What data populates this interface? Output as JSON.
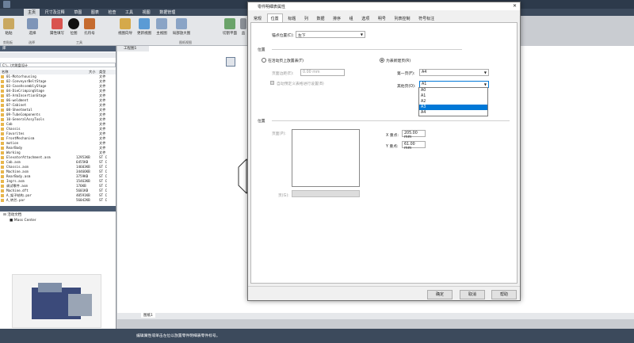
{
  "app": {
    "menus": [
      "主页",
      "尺寸及注释",
      "草图",
      "图表",
      "检查",
      "工具",
      "视图",
      "数据管理"
    ],
    "active_menu": "主页"
  },
  "ribbon": {
    "buttons": [
      "粘贴",
      "选择",
      "属性填写",
      "位图",
      "孔符号",
      "视图向导",
      "更新视图",
      "主视图",
      "局部放大图",
      "切割平面",
      "品"
    ],
    "groups": [
      "剪贴板",
      "选择",
      "工具",
      "图纸视图"
    ]
  },
  "left_panel": {
    "title": "库",
    "path": "C:\\...\\大跳盘设计",
    "columns": [
      "名称",
      "大小",
      "类型"
    ],
    "files": [
      {
        "name": "01-Motorhousing",
        "size": "",
        "type": "文件"
      },
      {
        "name": "02-ConveyorBeltStage",
        "size": "",
        "type": "文件"
      },
      {
        "name": "03-CaseAssemblyStage",
        "size": "",
        "type": "文件"
      },
      {
        "name": "04-DieCrimpingStage",
        "size": "",
        "type": "文件"
      },
      {
        "name": "05-ArmInsertionStage",
        "size": "",
        "type": "文件"
      },
      {
        "name": "06-weldment",
        "size": "",
        "type": "文件"
      },
      {
        "name": "07-Cabinet",
        "size": "",
        "type": "文件"
      },
      {
        "name": "08-Sheetmetal",
        "size": "",
        "type": "文件"
      },
      {
        "name": "09-TubeComponents",
        "size": "",
        "type": "文件"
      },
      {
        "name": "10-GeneralAssyTools",
        "size": "",
        "type": "文件"
      },
      {
        "name": "Cab",
        "size": "",
        "type": "文件"
      },
      {
        "name": "Chassis",
        "size": "",
        "type": "文件"
      },
      {
        "name": "Favorites",
        "size": "",
        "type": "文件"
      },
      {
        "name": "FrontMechanism",
        "size": "",
        "type": "文件"
      },
      {
        "name": "motion",
        "size": "",
        "type": "文件"
      },
      {
        "name": "RearBody",
        "size": "",
        "type": "文件"
      },
      {
        "name": "Working",
        "size": "",
        "type": "文件"
      },
      {
        "name": "ElevatorAttachment.asm",
        "size": "12953KB",
        "type": "ST C"
      },
      {
        "name": "Cab.asm",
        "size": "6455KB",
        "type": "ST C"
      },
      {
        "name": "Chassis.asm",
        "size": "14603KB",
        "type": "ST C"
      },
      {
        "name": "Machine.asm",
        "size": "34466KB",
        "type": "ST C"
      },
      {
        "name": "RearBody.asm",
        "size": "3759KB",
        "type": "ST C"
      },
      {
        "name": "Ingrs.asm",
        "size": "15463KB",
        "type": "ST C"
      },
      {
        "name": "调试零件.asm",
        "size": "176KB",
        "type": "ST C"
      },
      {
        "name": "Machine.dft",
        "size": "5601KB",
        "type": "ST C"
      },
      {
        "name": "A_架子结构.par",
        "size": "40591KB",
        "type": "ST C"
      },
      {
        "name": "A_转芯.par",
        "size": "56042KB",
        "type": "ST C"
      }
    ],
    "tree_root": "活动文档",
    "tree_child": "Mass Center"
  },
  "viewport": {
    "tab": "工程图1",
    "sheet_tab": "图纸1"
  },
  "dialog": {
    "title": "零件明细表属性",
    "tabs": [
      "常规",
      "位置",
      "标题",
      "列",
      "数据",
      "排序",
      "组",
      "选项",
      "明号",
      "列表控制",
      "符号标注"
    ],
    "selected_tab": "位置",
    "anchor_label": "锚点位置(C):",
    "anchor_value": "左下",
    "pos_section": "位置",
    "radio_active_sheet": "在活动页上放置表(T)",
    "page_edge_label": "页面边距(E):",
    "page_edge_value": "0.00 mm",
    "checkbox_preset": "自动预定义表格进行设置(B)",
    "radio_new_sheet": "为表新建页(R)",
    "first_page_label": "第一页(F):",
    "first_page_value": "A4",
    "other_page_label": "其他页(O):",
    "other_page_value": "A1",
    "dropdown_options": [
      "A0",
      "A1",
      "A2",
      "A3",
      "A4"
    ],
    "dropdown_highlight": "A3",
    "place_section": "位置",
    "page_label": "页面(P):",
    "page_value_label": "页(G):",
    "x_label": "X 重点:",
    "x_value": "205.00 mm",
    "y_label": "Y 重点:",
    "y_value": "61.00 mm",
    "ok": "确定",
    "cancel": "取消",
    "help": "帮助"
  },
  "status": {
    "text": "编辑属性或单击左位以放置零件明细表零件标号。"
  }
}
